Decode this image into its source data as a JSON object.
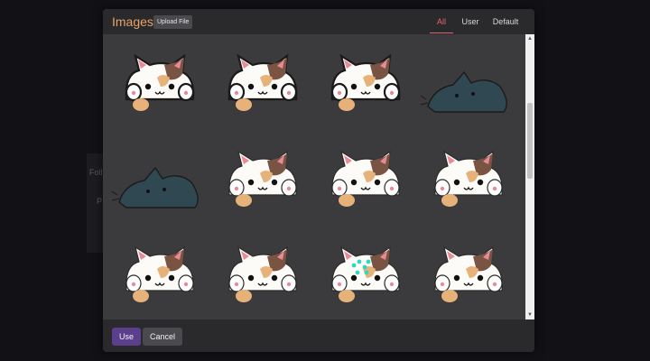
{
  "dialog": {
    "title": "Images",
    "upload_label": "Upload File",
    "tabs": [
      {
        "label": "All",
        "active": true
      },
      {
        "label": "User",
        "active": false
      },
      {
        "label": "Default",
        "active": false
      }
    ]
  },
  "background": {
    "fragments": [
      "Foll",
      "P"
    ]
  },
  "images": [
    {
      "kind": "calico-pixel"
    },
    {
      "kind": "calico-pixel"
    },
    {
      "kind": "calico-pixel"
    },
    {
      "kind": "dark-cat"
    },
    {
      "kind": "dark-cat"
    },
    {
      "kind": "calico"
    },
    {
      "kind": "calico"
    },
    {
      "kind": "calico"
    },
    {
      "kind": "calico"
    },
    {
      "kind": "calico"
    },
    {
      "kind": "calico-sparkle"
    },
    {
      "kind": "calico"
    }
  ],
  "footer": {
    "use_label": "Use",
    "cancel_label": "Cancel"
  },
  "colors": {
    "accent": "#e2646d",
    "title": "#e8a26a",
    "use_button": "#5b3e8c"
  }
}
